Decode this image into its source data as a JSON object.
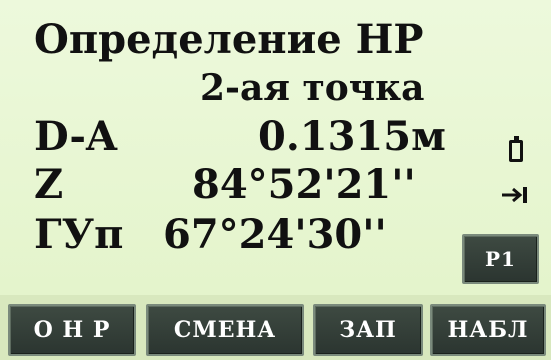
{
  "screen": {
    "title": "Определение НР",
    "subtitle": "2-ая точка",
    "rows": [
      {
        "label": "D-A",
        "value": "0.1315м"
      },
      {
        "label": "Z",
        "value": "84°52'21''"
      },
      {
        "label": "ГУп",
        "value": "67°24'30''"
      }
    ]
  },
  "status_icons": [
    "battery-icon",
    "target-arrow-icon"
  ],
  "page_button": {
    "label": "P1"
  },
  "softkeys": [
    {
      "label": "О Н Р"
    },
    {
      "label": "СМЕНА"
    },
    {
      "label": "ЗАП"
    },
    {
      "label": "НАБЛ"
    }
  ],
  "colors": {
    "background": "#e7f6cf",
    "button": "#344038",
    "text": "#111111"
  }
}
